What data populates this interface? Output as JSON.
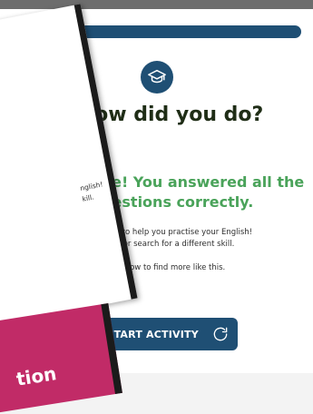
{
  "header": {
    "progress_label": ""
  },
  "main": {
    "title": "How did you do?",
    "result_line1": "Well done! You answered all the",
    "result_line2": "questions correctly.",
    "paragraph1_line1": "e lots more activities to help you practise your English!",
    "paragraph1_line2": "ose an activity below or search for a different skill.",
    "paragraph2_line1": "he related activities below to find more like this.",
    "restart_label": "RESTART ACTIVITY"
  },
  "overlay": {
    "line1": "nglish!",
    "line2": "kill.",
    "pink_text": "tion"
  },
  "colors": {
    "primary": "#1f4f74",
    "success": "#4aa35a",
    "overlay_pink": "#c12b67",
    "page_bg": "#f3f3f3"
  },
  "icons": {
    "top_icon": "graduation-cap-icon",
    "restart_icon": "refresh-icon"
  }
}
